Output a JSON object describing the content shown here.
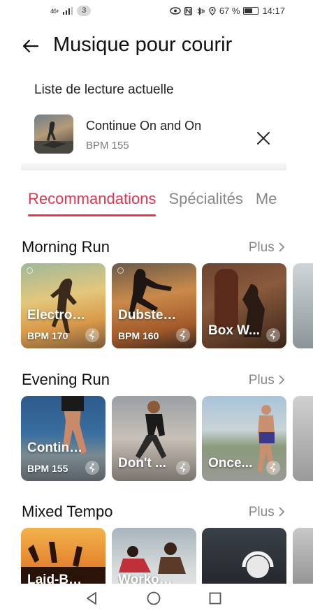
{
  "status_bar": {
    "network": "46+",
    "notification_count": "3",
    "battery": "67 %",
    "battery_level": 0.67,
    "time": "14:17"
  },
  "header": {
    "title": "Musique pour courir"
  },
  "current_playlist": {
    "label": "Liste de lecture actuelle",
    "title": "Continue On and On",
    "bpm": "BPM 155"
  },
  "tabs": [
    {
      "label": "Recommandations",
      "active": true
    },
    {
      "label": "Spécialités",
      "active": false
    },
    {
      "label": "Me",
      "active": false
    }
  ],
  "sections": [
    {
      "title": "Morning Run",
      "more": "Plus",
      "cards": [
        {
          "title": "Electro ...",
          "bpm": "BPM 170"
        },
        {
          "title": "Dubstep...",
          "bpm": "BPM 160"
        },
        {
          "title": "Box W...",
          "bpm": ""
        }
      ]
    },
    {
      "title": "Evening Run",
      "more": "Plus",
      "cards": [
        {
          "title": "Continu...",
          "bpm": "BPM 155"
        },
        {
          "title": "Don't ...",
          "bpm": ""
        },
        {
          "title": "Once...",
          "bpm": ""
        }
      ]
    },
    {
      "title": "Mixed Tempo",
      "more": "Plus",
      "cards": [
        {
          "title": "Laid-Ba...",
          "bpm": ""
        },
        {
          "title": "Workout ...",
          "bpm": ""
        },
        {
          "title": "",
          "bpm": ""
        }
      ]
    }
  ],
  "colors": {
    "accent": "#e5344f"
  }
}
